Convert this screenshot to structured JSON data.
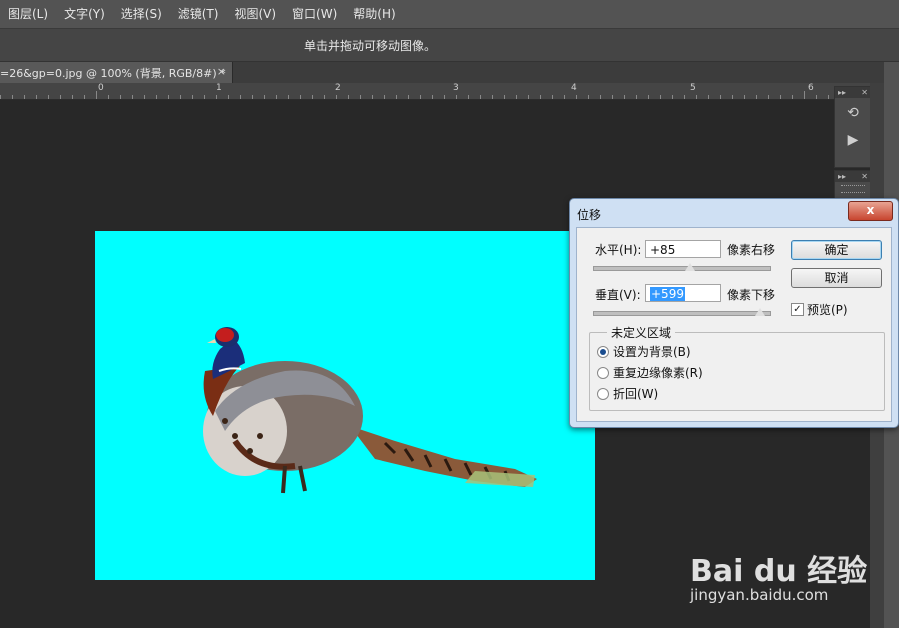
{
  "menu": [
    "图层(L)",
    "文字(Y)",
    "选择(S)",
    "滤镜(T)",
    "视图(V)",
    "窗口(W)",
    "帮助(H)"
  ],
  "options_bar": {
    "hint": "单击并拖动可移动图像。"
  },
  "document_tab": {
    "title": "=26&gp=0.jpg @ 100% (背景, RGB/8#) *",
    "close": "×"
  },
  "ruler": {
    "labels": [
      "0",
      "1",
      "2",
      "3",
      "4",
      "5",
      "6"
    ]
  },
  "canvas": {
    "background_color": "#00FFFF",
    "subject": "pheasant-image"
  },
  "dialog": {
    "title": "位移",
    "close": "x",
    "horizontal": {
      "label": "水平(H):",
      "value": "+85",
      "unit": "像素右移",
      "slider_fraction": 0.55
    },
    "vertical": {
      "label": "垂直(V):",
      "value": "+599",
      "unit": "像素下移",
      "slider_fraction": 0.95
    },
    "ok": "确定",
    "cancel": "取消",
    "preview": {
      "label": "预览(P)",
      "checked": true
    },
    "undefined_area": {
      "title": "未定义区域",
      "options": [
        {
          "label": "设置为背景(B)",
          "selected": true
        },
        {
          "label": "重复边缘像素(R)",
          "selected": false
        },
        {
          "label": "折回(W)",
          "selected": false
        }
      ]
    }
  },
  "watermark": {
    "brand": "Bai du 经验",
    "url": "jingyan.baidu.com"
  }
}
